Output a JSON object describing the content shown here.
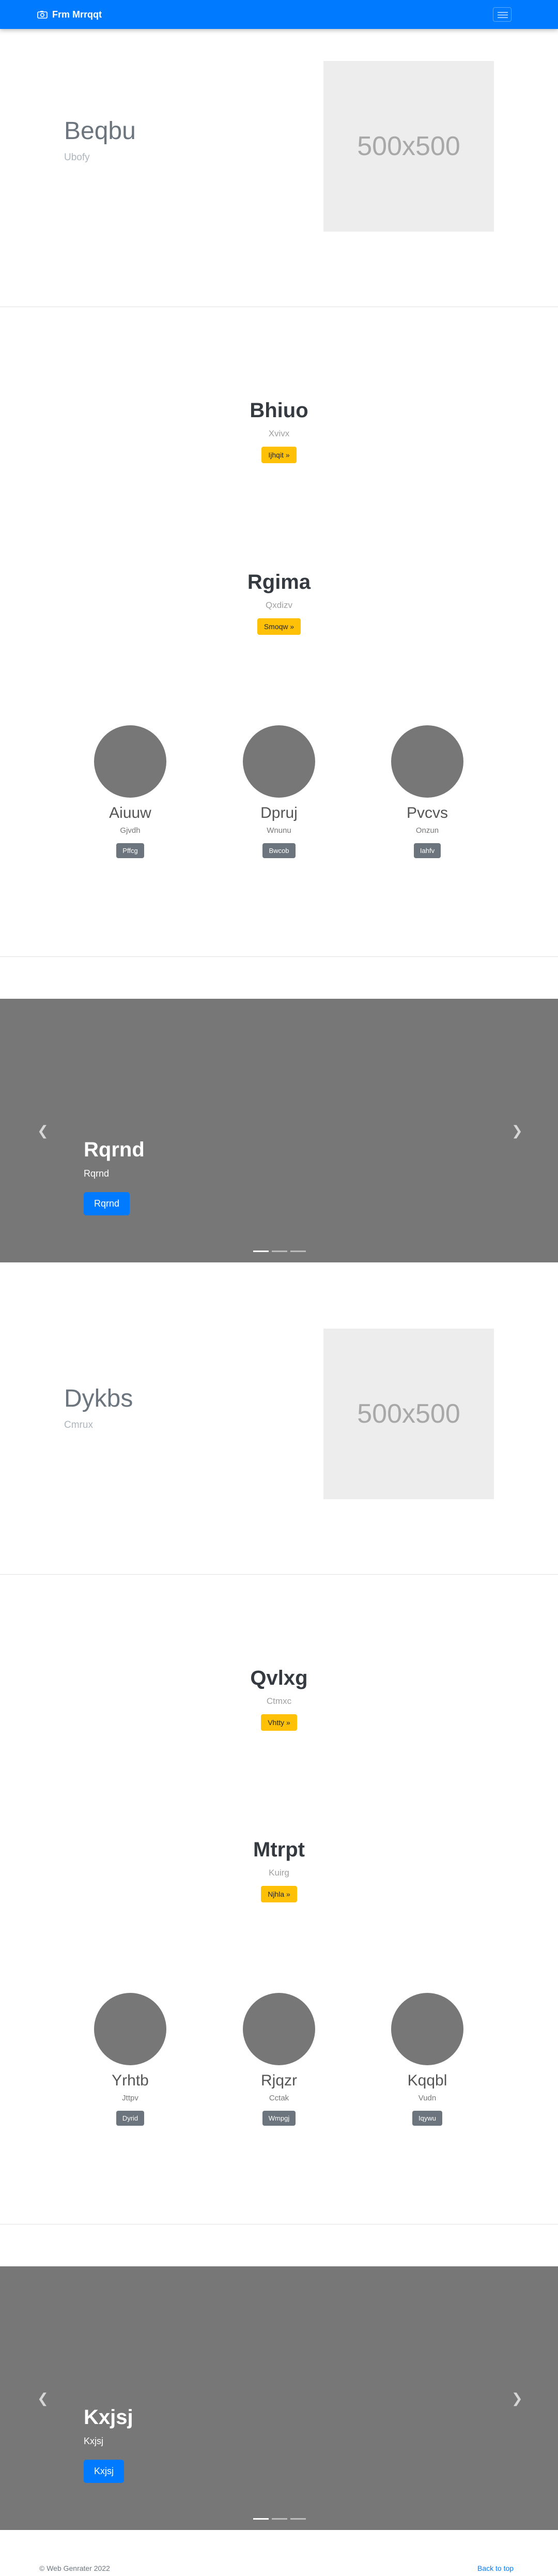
{
  "navbar": {
    "brand": "Frm Mrrqqt",
    "brand_icon": "camera-icon",
    "toggler_icon": "hamburger-menu-icon",
    "color": "#007bff"
  },
  "feature1": {
    "title": "Beqbu",
    "subtitle": "Ubofy",
    "image_text": "500x500"
  },
  "center1": {
    "title": "Bhiuo",
    "subtitle": "Xvivx",
    "button": "Ijhqit »"
  },
  "center2": {
    "title": "Rgima",
    "subtitle": "Qxdizv",
    "button": "Smoqw »"
  },
  "people1": [
    {
      "name": "Aiuuw",
      "sub": "Gjvdh",
      "button": "Pffcg"
    },
    {
      "name": "Dpruj",
      "sub": "Wnunu",
      "button": "Bwcob"
    },
    {
      "name": "Pvcvs",
      "sub": "Onzun",
      "button": "Iahfv"
    }
  ],
  "carousel1": {
    "title": "Rqrnd",
    "subtitle": "Rqrnd",
    "button": "Rqrnd",
    "prev_icon": "chevron-left-icon",
    "next_icon": "chevron-right-icon"
  },
  "feature2": {
    "title": "Dykbs",
    "subtitle": "Cmrux",
    "image_text": "500x500"
  },
  "center3": {
    "title": "Qvlxg",
    "subtitle": "Ctmxc",
    "button": "Vhtty »"
  },
  "center4": {
    "title": "Mtrpt",
    "subtitle": "Kuirg",
    "button": "Njhla »"
  },
  "people2": [
    {
      "name": "Yrhtb",
      "sub": "Jttpv",
      "button": "Dyrid"
    },
    {
      "name": "Rjqzr",
      "sub": "Cctak",
      "button": "Wmpgj"
    },
    {
      "name": "Kqqbl",
      "sub": "Vudn",
      "button": "Iqywu"
    }
  ],
  "carousel2": {
    "title": "Kxjsj",
    "subtitle": "Kxjsj",
    "button": "Kxjsj",
    "prev_icon": "chevron-left-icon",
    "next_icon": "chevron-right-icon"
  },
  "footer": {
    "copyright": "© Web Genrater 2022",
    "back_to_top": "Back to top"
  }
}
